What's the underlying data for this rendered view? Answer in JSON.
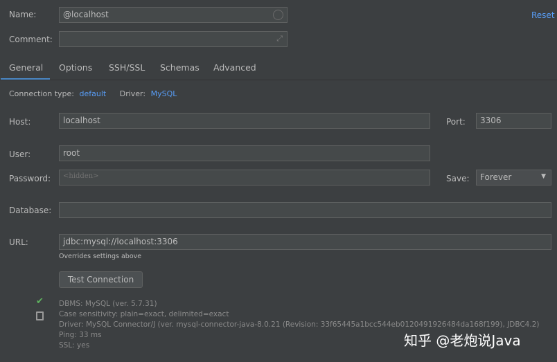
{
  "name": {
    "label": "Name:",
    "value": "@localhost"
  },
  "comment": {
    "label": "Comment:",
    "value": ""
  },
  "reset": "Reset",
  "tabs": [
    {
      "label": "General",
      "active": true
    },
    {
      "label": "Options"
    },
    {
      "label": "SSH/SSL"
    },
    {
      "label": "Schemas"
    },
    {
      "label": "Advanced"
    }
  ],
  "connection": {
    "type_label": "Connection type:",
    "type_value": "default",
    "driver_label": "Driver:",
    "driver_value": "MySQL"
  },
  "host": {
    "label": "Host:",
    "value": "localhost"
  },
  "port": {
    "label": "Port:",
    "value": "3306"
  },
  "user": {
    "label": "User:",
    "value": "root"
  },
  "password": {
    "label": "Password:",
    "placeholder": "<hidden>"
  },
  "save": {
    "label": "Save:",
    "value": "Forever"
  },
  "database": {
    "label": "Database:",
    "value": ""
  },
  "url": {
    "label": "URL:",
    "value": "jdbc:mysql://localhost:3306",
    "hint": "Overrides settings above"
  },
  "test_button": "Test Connection",
  "result": [
    "DBMS: MySQL (ver. 5.7.31)",
    "Case sensitivity: plain=exact, delimited=exact",
    "Driver: MySQL Connector/J (ver. mysql-connector-java-8.0.21 (Revision: 33f65445a1bcc544eb0120491926484da168f199), JDBC4.2)",
    "Ping: 33 ms",
    "SSL: yes"
  ],
  "watermark": "知乎 @老炮说Java",
  "colors": {
    "accent": "#589df6",
    "success": "#5fb35f",
    "background": "#3c3f41"
  }
}
